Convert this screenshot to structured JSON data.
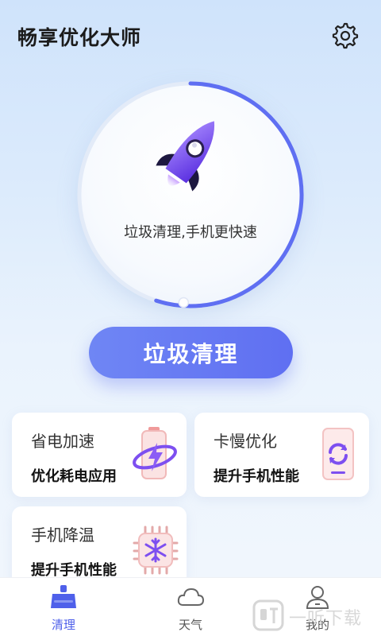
{
  "header": {
    "title": "畅享优化大师",
    "settings_icon": "gear-icon"
  },
  "dial": {
    "progress": 0.55,
    "tagline": "垃圾清理,手机更快速",
    "icon": "rocket-icon"
  },
  "main_button": {
    "label": "垃圾清理"
  },
  "cards": [
    {
      "title": "省电加速",
      "subtitle": "优化耗电应用",
      "icon": "battery-icon"
    },
    {
      "title": "卡慢优化",
      "subtitle": "提升手机性能",
      "icon": "phone-refresh-icon"
    },
    {
      "title": "手机降温",
      "subtitle": "提升手机性能",
      "icon": "snowflake-chip-icon"
    }
  ],
  "tabs": [
    {
      "label": "清理",
      "icon": "broom-icon",
      "active": true
    },
    {
      "label": "天气",
      "icon": "cloud-icon",
      "active": false
    },
    {
      "label": "我的",
      "icon": "user-icon",
      "active": false
    }
  ],
  "colors": {
    "accent": "#5f6ff2",
    "accent_light": "#6f86f4",
    "rocket": "#7d4ff0"
  },
  "watermark": {
    "text": "一听下载"
  }
}
